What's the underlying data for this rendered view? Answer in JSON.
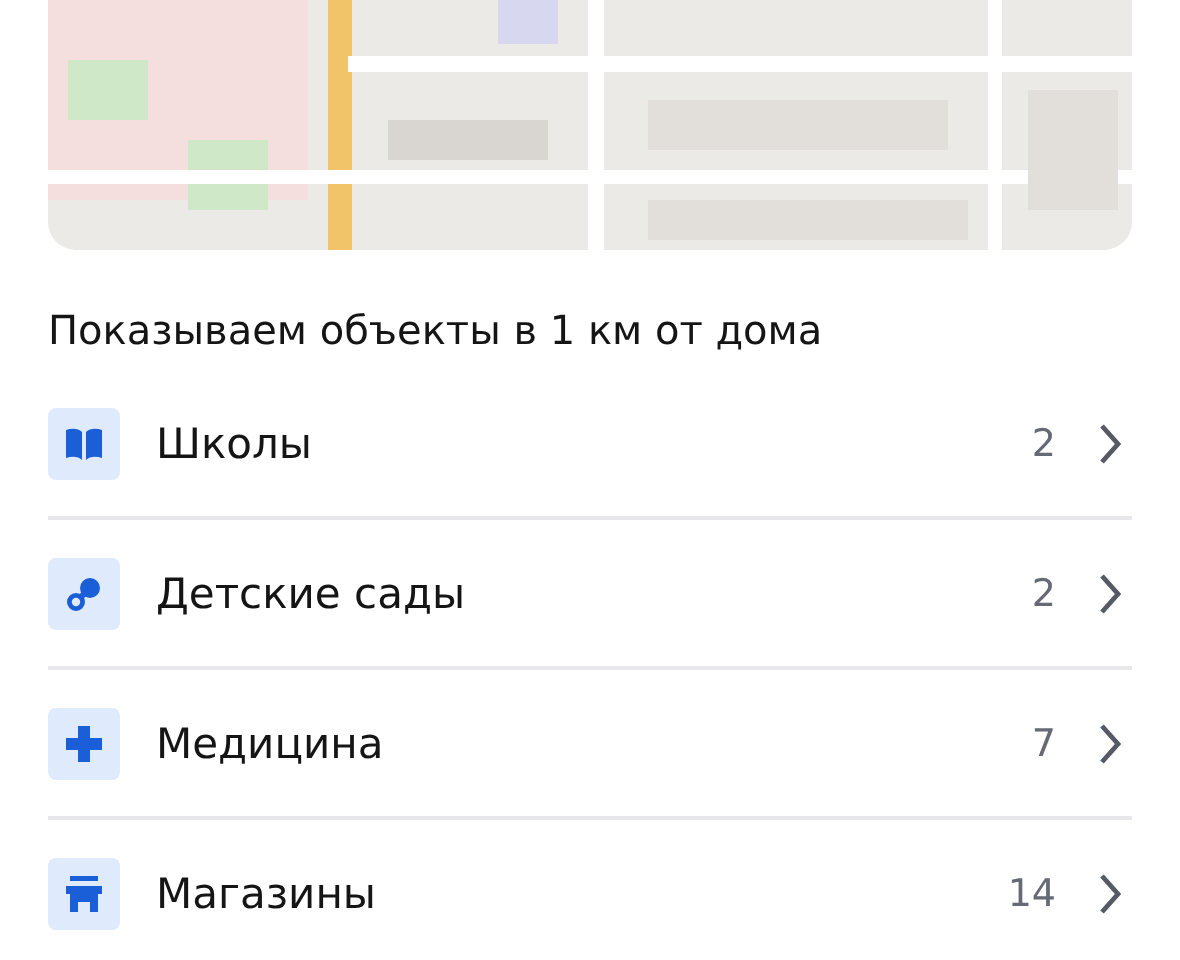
{
  "heading": "Показываем объекты в 1 км от дома",
  "categories": [
    {
      "kind": "book",
      "label": "Школы",
      "count": "2"
    },
    {
      "kind": "pacifier",
      "label": "Детские сады",
      "count": "2"
    },
    {
      "kind": "plus",
      "label": "Медицина",
      "count": "7"
    },
    {
      "kind": "store",
      "label": "Магазины",
      "count": "14"
    }
  ]
}
